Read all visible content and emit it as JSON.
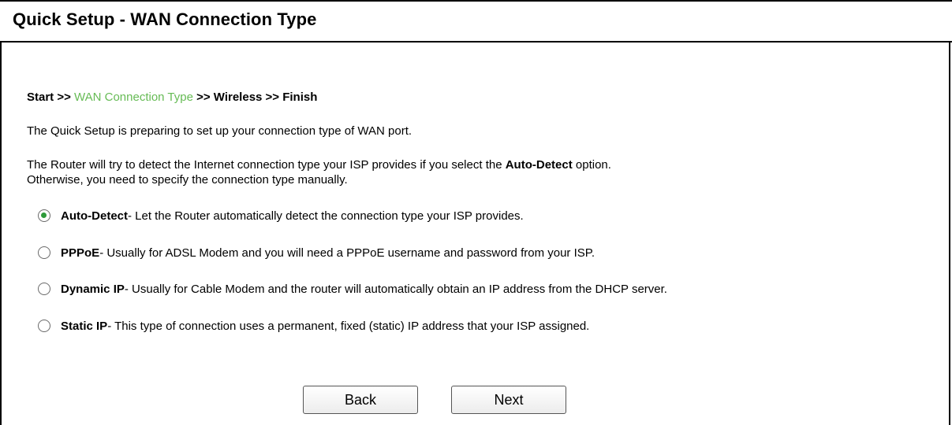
{
  "header": {
    "title": "Quick Setup - WAN Connection Type"
  },
  "breadcrumb": {
    "start": "Start >> ",
    "current": "WAN Connection Type",
    "rest": " >> Wireless >> Finish"
  },
  "intro": {
    "line1": "The Quick Setup is preparing to set up your connection type of WAN port.",
    "line2_pre": "The Router will try to detect the Internet connection type your ISP provides if you select the ",
    "line2_bold": "Auto-Detect",
    "line2_post": " option.",
    "line3": "Otherwise, you need to specify the connection type manually."
  },
  "options": [
    {
      "label": "Auto-Detect",
      "desc": " - Let the Router automatically detect the connection type your ISP provides.",
      "checked": true
    },
    {
      "label": "PPPoE",
      "desc": " - Usually for ADSL Modem and you will need a PPPoE username and password from your ISP.",
      "checked": false
    },
    {
      "label": "Dynamic IP",
      "desc": " - Usually for Cable Modem and the router will automatically obtain an IP address from the DHCP server.",
      "checked": false
    },
    {
      "label": "Static IP",
      "desc": " - This type of connection uses a permanent, fixed (static) IP address that your ISP assigned.",
      "checked": false
    }
  ],
  "buttons": {
    "back": "Back",
    "next": "Next"
  },
  "colors": {
    "breadcrumb_active": "#66bb55",
    "radio_dot": "#2e9a3a"
  }
}
